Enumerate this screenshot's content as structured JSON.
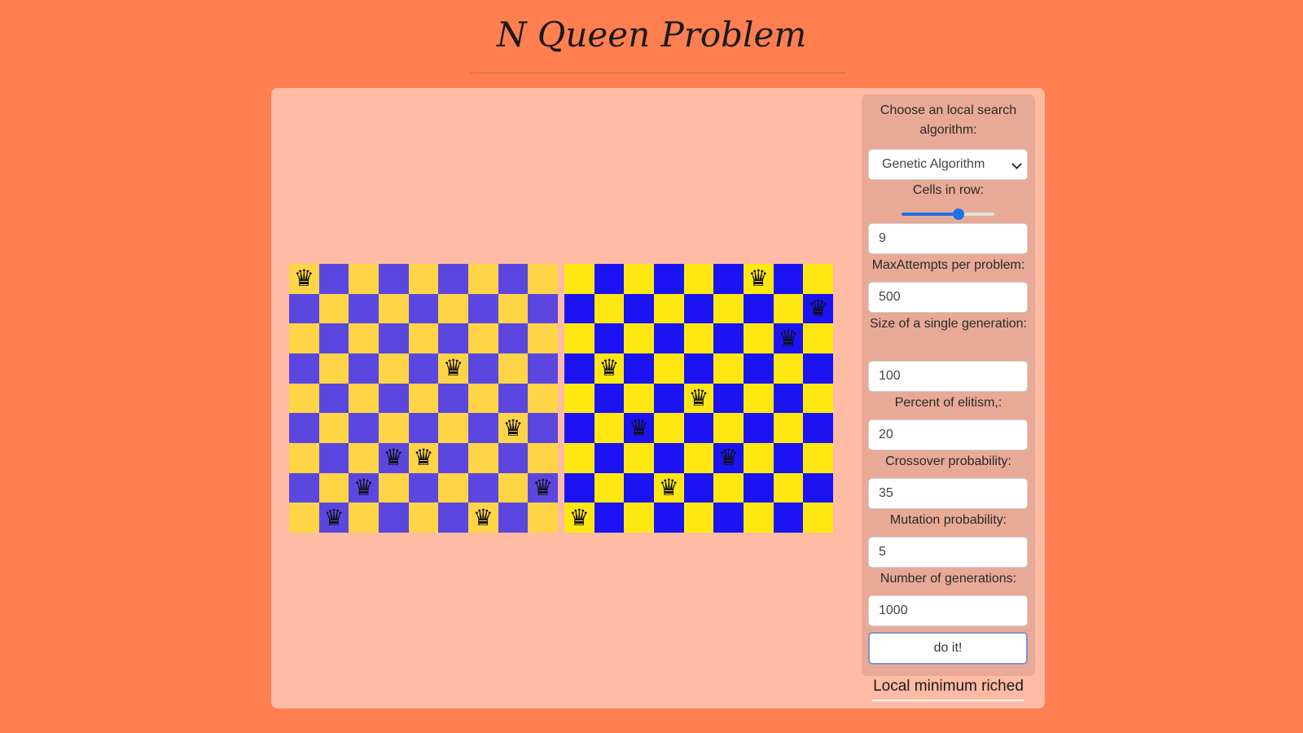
{
  "page": {
    "title": "N Queen Problem",
    "status": "Local minimum riched"
  },
  "colors": {
    "background": "#ff7f50",
    "panel": "#ffbba4",
    "controls_panel": "#e8aa96",
    "board1_dark": "#5b47df",
    "board1_light": "#ffd447",
    "board2_dark": "#1b13f2",
    "board2_light": "#ffe812",
    "accent": "#1a73e8"
  },
  "boards": [
    {
      "size": 9,
      "piece_icon": "chess-queen-icon",
      "queens": [
        [
          0,
          0
        ],
        [
          3,
          5
        ],
        [
          5,
          7
        ],
        [
          6,
          3
        ],
        [
          6,
          4
        ],
        [
          7,
          2
        ],
        [
          7,
          8
        ],
        [
          8,
          1
        ],
        [
          8,
          6
        ]
      ]
    },
    {
      "size": 9,
      "piece_icon": "chess-queen-icon",
      "queens": [
        [
          0,
          6
        ],
        [
          1,
          8
        ],
        [
          2,
          7
        ],
        [
          3,
          1
        ],
        [
          4,
          4
        ],
        [
          5,
          2
        ],
        [
          6,
          5
        ],
        [
          7,
          3
        ],
        [
          8,
          0
        ]
      ]
    }
  ],
  "controls": {
    "algorithm_label": "Choose an local search algorithm:",
    "algorithm_value": "Genetic Algorithm",
    "cells_label": "Cells in row:",
    "cells_slider_fraction": 0.61,
    "cells_value": "9",
    "max_attempts_label": "MaxAttempts per problem:",
    "max_attempts_value": "500",
    "generation_size_label": "Size of a single generation:",
    "generation_size_value": "100",
    "elitism_label": "Percent of elitism,:",
    "elitism_value": "20",
    "crossover_label": "Crossover probability:",
    "crossover_value": "35",
    "mutation_label": "Mutation probability:",
    "mutation_value": "5",
    "generations_label": "Number of generations:",
    "generations_value": "1000",
    "submit_label": "do it!"
  }
}
